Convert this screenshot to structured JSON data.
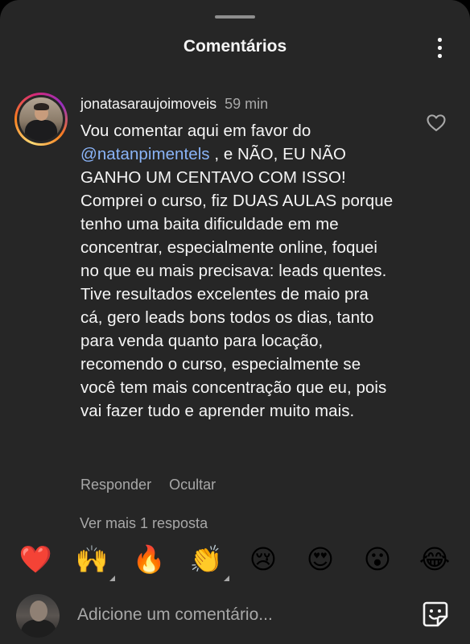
{
  "header": {
    "title": "Comentários"
  },
  "comment": {
    "username": "jonatasaraujoimoveis",
    "time": "59 min",
    "mention": "@natanpimentels",
    "text_before": "Vou comentar aqui em favor do",
    "text_after": ", e NÃO, EU NÃO GANHO UM CENTAVO COM ISSO! Comprei o curso, fiz DUAS AULAS porque tenho uma baita dificuldade em me concentrar, especialmente online, foquei no que eu mais precisava: leads quentes. Tive resultados excelentes de maio pra cá, gero leads bons todos os dias, tanto para venda quanto para locação, recomendo o curso, especialmente se você tem mais concentração que eu, pois vai fazer tudo e aprender muito mais.",
    "reply_label": "Responder",
    "hide_label": "Ocultar",
    "more_replies_label": "Ver mais 1 resposta"
  },
  "reactions": [
    {
      "name": "red-heart",
      "glyph": "❤️",
      "has_variants": false
    },
    {
      "name": "raising-hands",
      "glyph": "🙌",
      "has_variants": true
    },
    {
      "name": "fire",
      "glyph": "🔥",
      "has_variants": false
    },
    {
      "name": "clapping-hands",
      "glyph": "👏",
      "has_variants": true
    },
    {
      "name": "crying-face",
      "glyph": "😢",
      "has_variants": false
    },
    {
      "name": "heart-eyes",
      "glyph": "😍",
      "has_variants": false
    },
    {
      "name": "surprised-face",
      "glyph": "😮",
      "has_variants": false
    },
    {
      "name": "tears-of-joy",
      "glyph": "😂",
      "has_variants": false
    }
  ],
  "composer": {
    "placeholder": "Adicione um comentário..."
  },
  "colors": {
    "background": "#262626",
    "text_primary": "#f5f5f5",
    "text_secondary": "#a8a8a8",
    "mention": "#8ab4f8"
  },
  "icons": {
    "menu": "vertical-dots-icon",
    "like": "heart-outline-icon",
    "sticker": "sticker-icon"
  }
}
